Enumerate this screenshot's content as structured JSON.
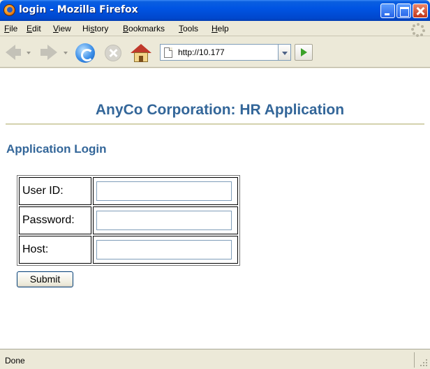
{
  "window": {
    "title": "login - Mozilla Firefox"
  },
  "menubar": {
    "items": [
      {
        "accel": "F",
        "rest": "ile"
      },
      {
        "accel": "E",
        "rest": "dit"
      },
      {
        "accel": "V",
        "rest": "iew"
      },
      {
        "pre": "Hi",
        "accel": "s",
        "rest": "tory"
      },
      {
        "accel": "B",
        "rest": "ookmarks"
      },
      {
        "accel": "T",
        "rest": "ools"
      },
      {
        "accel": "H",
        "rest": "elp"
      }
    ]
  },
  "navbar": {
    "url": "http://10.177"
  },
  "page": {
    "header": "AnyCo Corporation: HR Application",
    "section_title": "Application Login",
    "fields": [
      {
        "label": "User ID:",
        "value": ""
      },
      {
        "label": "Password:",
        "value": ""
      },
      {
        "label": "Host:",
        "value": ""
      }
    ],
    "submit_label": "Submit"
  },
  "statusbar": {
    "text": "Done"
  }
}
